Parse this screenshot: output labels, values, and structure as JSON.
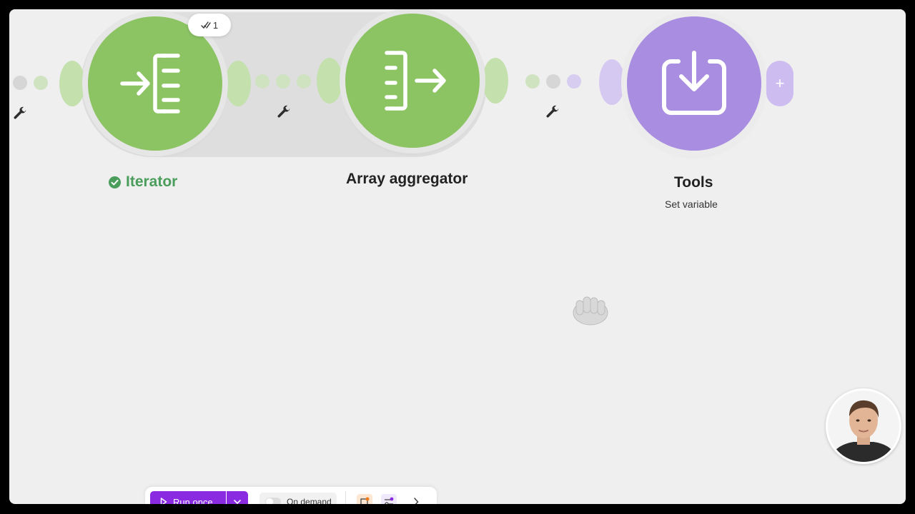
{
  "canvas": {
    "modules": [
      {
        "id": "iterator",
        "label": "Iterator",
        "status": "success",
        "icon": "iterator-icon",
        "color": "#8cc464"
      },
      {
        "id": "array-aggregator",
        "label": "Array aggregator",
        "icon": "array-aggregator-icon",
        "color": "#8cc464"
      },
      {
        "id": "tools",
        "label": "Tools",
        "sublabel": "Set variable",
        "icon": "set-variable-icon",
        "color": "#a98de0"
      }
    ],
    "badge": {
      "count": "1",
      "icon": "double-check-icon"
    },
    "add_module_symbol": "+"
  },
  "toolbar": {
    "run_once_label": "Run once",
    "schedule_label": "On demand"
  },
  "colors": {
    "accent": "#8a2be2",
    "success": "#4a9d5b",
    "module_green": "#8cc464",
    "module_purple": "#a98de0"
  }
}
